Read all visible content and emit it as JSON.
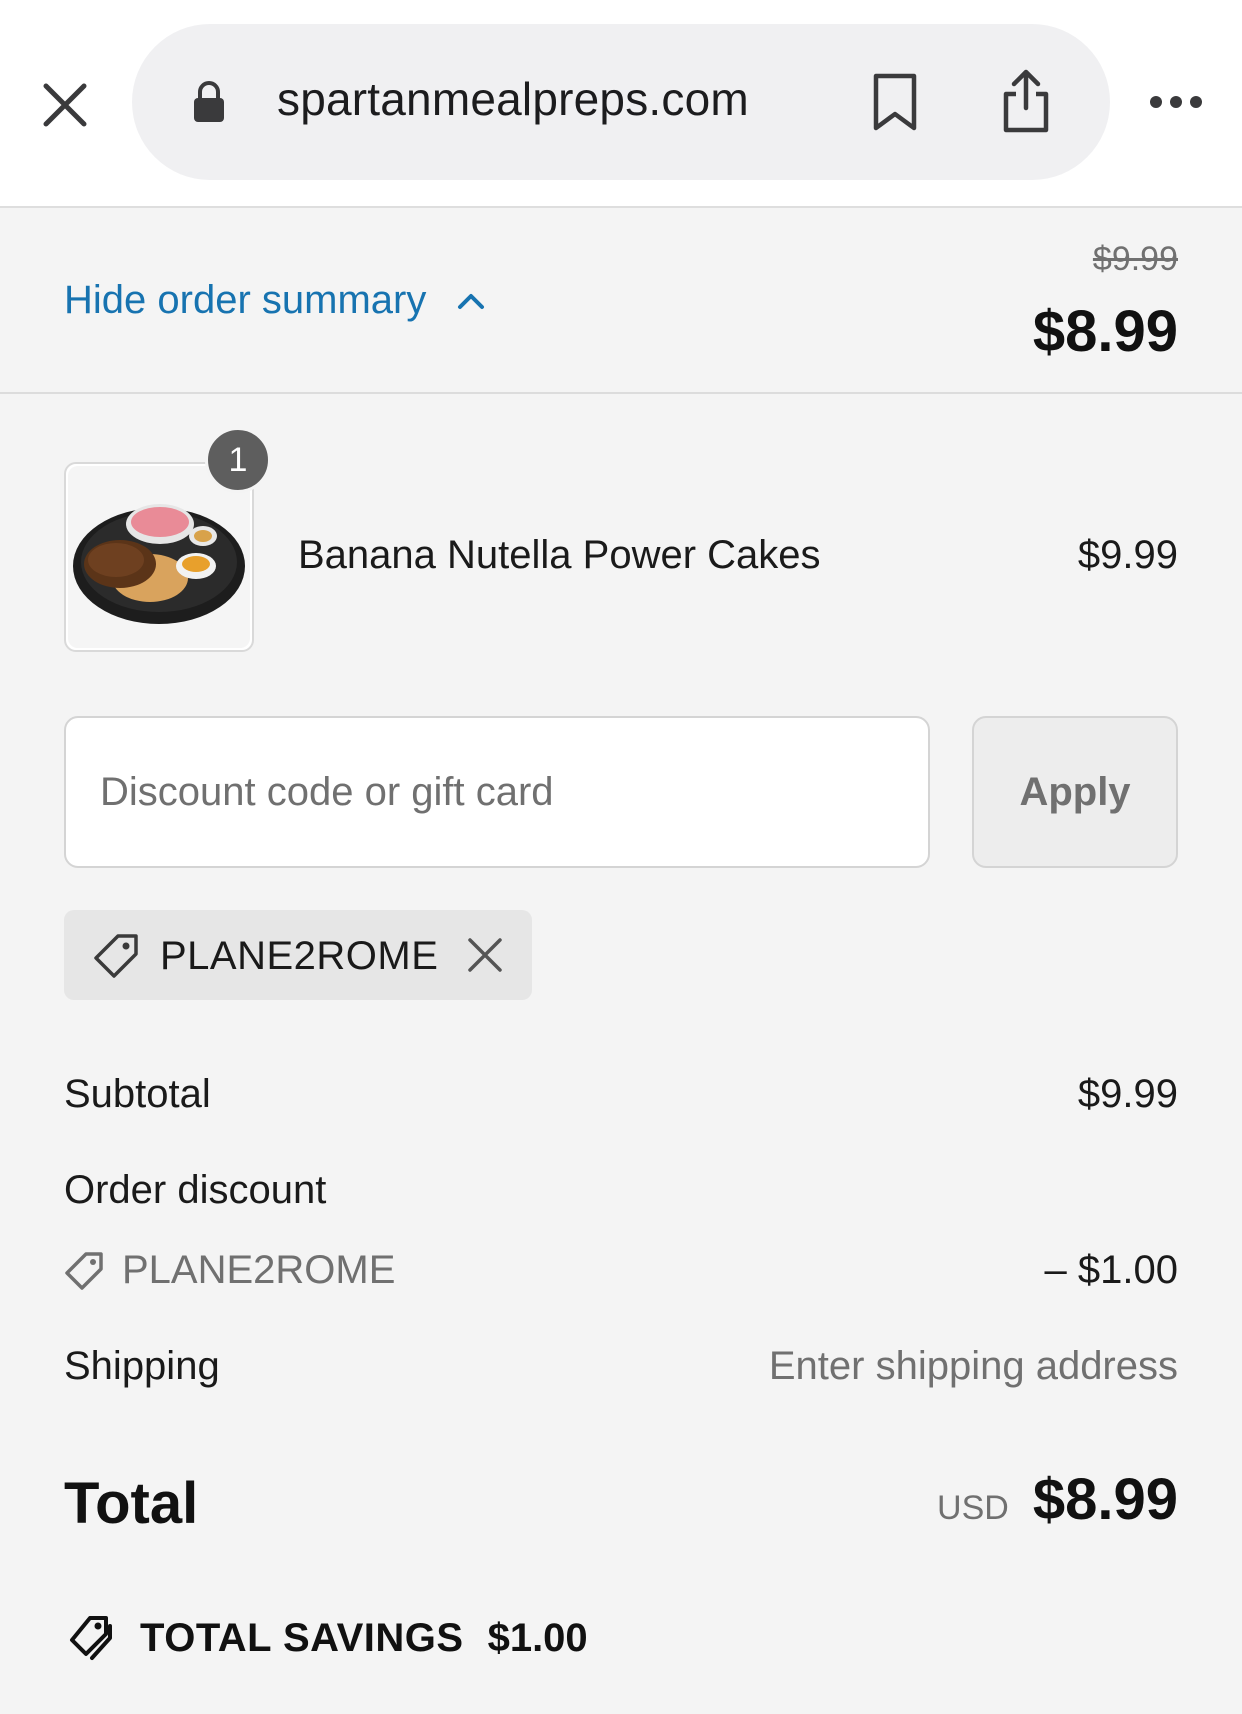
{
  "browser": {
    "url": "spartanmealpreps.com"
  },
  "summary": {
    "toggle_label": "Hide order summary",
    "original_price": "$9.99",
    "price": "$8.99"
  },
  "line_item": {
    "quantity": "1",
    "name": "Banana Nutella Power Cakes",
    "price": "$9.99"
  },
  "discount": {
    "placeholder": "Discount code or gift card",
    "value": "",
    "apply_label": "Apply",
    "applied_code": "PLANE2ROME"
  },
  "totals": {
    "subtotal_label": "Subtotal",
    "subtotal_value": "$9.99",
    "order_discount_label": "Order discount",
    "discount_code": "PLANE2ROME",
    "discount_value": "– $1.00",
    "shipping_label": "Shipping",
    "shipping_value": "Enter shipping address",
    "total_label": "Total",
    "currency": "USD",
    "total_value": "$8.99"
  },
  "savings": {
    "label": "TOTAL SAVINGS",
    "amount": "$1.00"
  },
  "colors": {
    "link": "#1773b0",
    "background": "#f4f4f4",
    "muted_text": "#707070"
  }
}
